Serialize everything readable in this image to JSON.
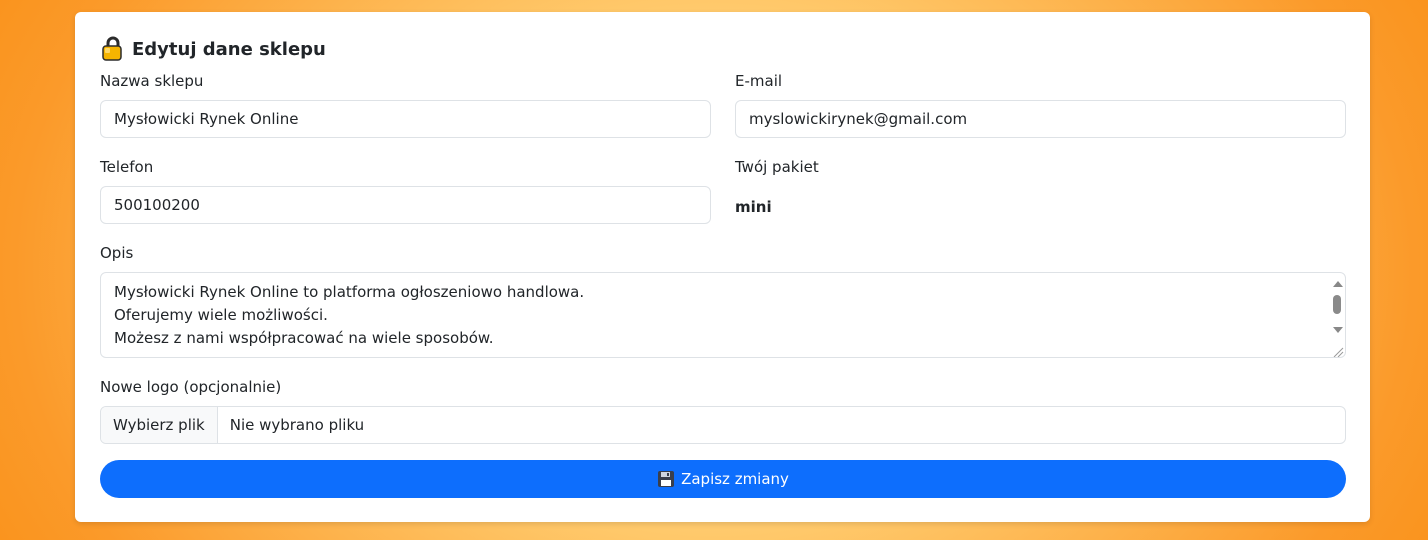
{
  "form": {
    "title": "Edytuj dane sklepu",
    "title_icon": "lock-icon",
    "shop_name": {
      "label": "Nazwa sklepu",
      "value": "Mysłowicki Rynek Online"
    },
    "email": {
      "label": "E-mail",
      "value": "myslowickirynek@gmail.com"
    },
    "phone": {
      "label": "Telefon",
      "value": "500100200"
    },
    "plan": {
      "label": "Twój pakiet",
      "value": "mini"
    },
    "description": {
      "label": "Opis",
      "lines": [
        "Mysłowicki Rynek Online to platforma ogłoszeniowo handlowa.",
        "Oferujemy wiele możliwości.",
        "Możesz z nami współpracować na wiele sposobów."
      ]
    },
    "logo": {
      "label": "Nowe logo (opcjonalnie)",
      "button": "Wybierz plik",
      "status": "Nie wybrano pliku"
    },
    "save": {
      "icon": "floppy-disk-icon",
      "label": "Zapisz zmiany"
    }
  },
  "colors": {
    "primary": "#0d6efd",
    "background_orange": "#f78806",
    "text": "#212529",
    "border": "#dee2e6"
  }
}
